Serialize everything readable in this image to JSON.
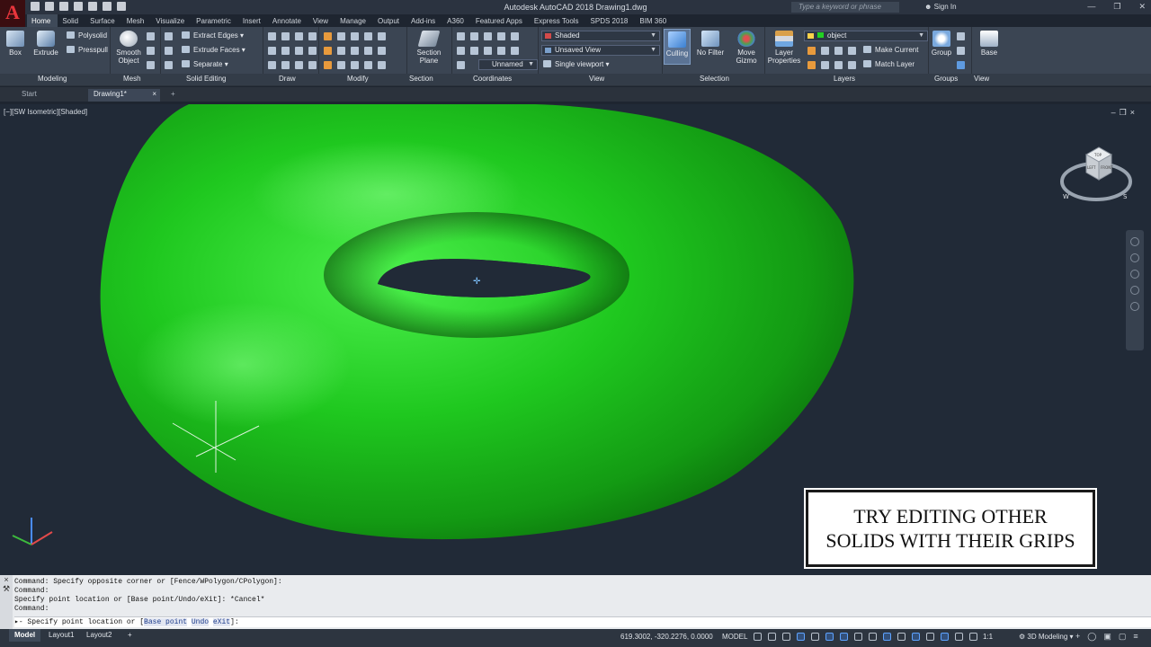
{
  "app": {
    "logo": "A",
    "title": "Autodesk AutoCAD 2018   Drawing1.dwg",
    "search_placeholder": "Type a keyword or phrase",
    "signin": "Sign In"
  },
  "ribbon_tabs": [
    "Home",
    "Solid",
    "Surface",
    "Mesh",
    "Visualize",
    "Parametric",
    "Insert",
    "Annotate",
    "View",
    "Manage",
    "Output",
    "Add-ins",
    "A360",
    "Featured Apps",
    "Express Tools",
    "SPDS 2018",
    "BIM 360"
  ],
  "ribbon": {
    "box": "Box",
    "extrude": "Extrude",
    "polysolid": "Polysolid",
    "presspull": "Presspull",
    "smooth_object": "Smooth Object",
    "extract_edges": "Extract Edges",
    "extrude_faces": "Extrude Faces",
    "separate": "Separate",
    "section_plane": "Section Plane",
    "visual_style": "Shaded",
    "saved_view": "Unsaved View",
    "ucs_name": "Unnamed",
    "viewport_config": "Single viewport",
    "culling": "Culling",
    "no_filter": "No Filter",
    "move_gizmo": "Move Gizmo",
    "layer_properties": "Layer Properties",
    "layer_name": "object",
    "make_current": "Make Current",
    "match_layer": "Match Layer",
    "group": "Group",
    "base": "Base"
  },
  "panel_labels": [
    "Modeling",
    "Mesh",
    "Solid Editing",
    "Draw",
    "Modify",
    "Section",
    "Coordinates",
    "View",
    "Selection",
    "Layers",
    "Groups",
    "View"
  ],
  "doc_tabs": [
    "Start",
    "Drawing1*"
  ],
  "viewport": {
    "label": "[−][SW Isometric][Shaded]",
    "viewcube_top": "TOP",
    "viewcube_left": "LEFT",
    "viewcube_front": "FRONT",
    "compass_w": "W",
    "compass_s": "S",
    "torus_color": "#1fc81f"
  },
  "caption": {
    "line1": "TRY EDITING OTHER",
    "line2": "SOLIDS WITH THEIR GRIPS"
  },
  "command": {
    "history": [
      "Command: Specify opposite corner or [Fence/WPolygon/CPolygon]:",
      "Command:",
      "Specify point location or [Base point/Undo/eXit]: *Cancel*",
      "Command:"
    ],
    "prompt": "Specify point location or [",
    "option1": "Base point",
    "option2": "Undo",
    "option3": "eXit",
    "prompt_end": "]:"
  },
  "status_bar": {
    "layout_tabs": [
      "Model",
      "Layout1",
      "Layout2"
    ],
    "coordinates": "619.3002, -320.2276, 0.0000",
    "space": "MODEL",
    "annotation_scale": "1:1",
    "workspace": "3D Modeling"
  }
}
